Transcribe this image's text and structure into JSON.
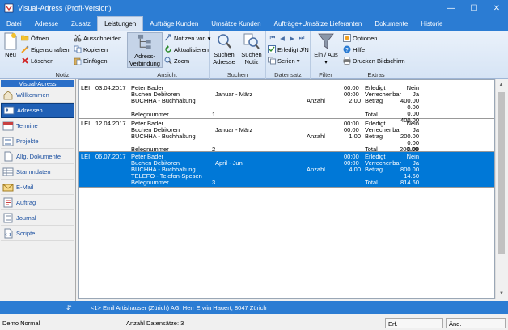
{
  "window": {
    "title": "Visual-Adress (Profi-Version)",
    "minimize": "—",
    "maximize": "☐",
    "close": "✕"
  },
  "menu": {
    "tabs": [
      "Datei",
      "Adresse",
      "Zusatz",
      "Leistungen",
      "Aufträge Kunden",
      "Umsätze Kunden",
      "Aufträge+Umsätze Lieferanten",
      "Dokumente",
      "Historie"
    ],
    "active": "Leistungen"
  },
  "ribbon": {
    "notiz": {
      "label": "Notiz",
      "neu": "Neu",
      "oeffnen": "Öffnen",
      "eigenschaften": "Eigenschaften",
      "loeschen": "Löschen",
      "ausschneiden": "Ausschneiden",
      "kopieren": "Kopieren",
      "einfuegen": "Einfügen"
    },
    "ansicht": {
      "label": "Ansicht",
      "adress_verbindung": "Adress-\nVerbindung",
      "notizen_von": "Notizen von",
      "aktualisieren": "Aktualisieren",
      "zoom": "Zoom"
    },
    "suchen": {
      "label": "Suchen",
      "suchen_adresse": "Suchen\nAdresse",
      "suchen_notiz": "Suchen\nNotiz"
    },
    "datensatz": {
      "label": "Datensatz",
      "erledigt": "Erledigt J/N",
      "serien": "Serien"
    },
    "filter": {
      "label": "Filter",
      "ein_aus": "Ein / Aus"
    },
    "extras": {
      "label": "Extras",
      "optionen": "Optionen",
      "hilfe": "Hilfe",
      "drucken": "Drucken Bildschirm"
    }
  },
  "sidebar": {
    "header": "Visual-Adress",
    "items": [
      "Willkommen",
      "Adressen",
      "Termine",
      "Projekte",
      "Allg. Dokumente",
      "Stammdaten",
      "E-Mail",
      "Auftrag",
      "Journal",
      "Scripte"
    ],
    "active": "Adressen"
  },
  "entries": [
    {
      "type": "LEI",
      "date": "03.04.2017",
      "user": "Peter Bader",
      "kind": "Buchen Debitoren",
      "period": "Januar - März",
      "account": "BUCHHA - Buchhaltung",
      "amount_label": "Anzahl",
      "amount": "2.00",
      "extra": "",
      "beleg_label": "Belegnummer",
      "beleg": "1",
      "time1": "00:00",
      "time2": "00:00",
      "erledigt_label": "Erledigt",
      "erledigt": "Nein",
      "verrechenbar_label": "Verrechenbar",
      "verrechenbar": "Ja",
      "betrag_label": "Betrag",
      "betrag": "400.00",
      "sub1": "0.00",
      "sub2": "0.00",
      "total_label": "Total",
      "total": "400.00"
    },
    {
      "type": "LEI",
      "date": "12.04.2017",
      "user": "Peter Bader",
      "kind": "Buchen Debitoren",
      "period": "Januar - März",
      "account": "BUCHHA - Buchhaltung",
      "amount_label": "Anzahl",
      "amount": "1.00",
      "extra": "",
      "beleg_label": "Belegnummer",
      "beleg": "2",
      "time1": "00:00",
      "time2": "00:00",
      "erledigt_label": "Erledigt",
      "erledigt": "Nein",
      "verrechenbar_label": "Verrechenbar",
      "verrechenbar": "Ja",
      "betrag_label": "Betrag",
      "betrag": "200.00",
      "sub1": "0.00",
      "sub2": "0.00",
      "total_label": "Total",
      "total": "200.00"
    },
    {
      "type": "LEI",
      "date": "06.07.2017",
      "user": "Peter Bader",
      "kind": "Buchen Debitoren",
      "period": "April - Juni",
      "account": "BUCHHA - Buchhaltung",
      "amount_label": "Anzahl",
      "amount": "4.00",
      "extra": "TELEFO - Telefon-Spesen",
      "beleg_label": "Belegnummer",
      "beleg": "3",
      "time1": "00:00",
      "time2": "00:00",
      "erledigt_label": "Erledigt",
      "erledigt": "Nein",
      "verrechenbar_label": "Verrechenbar",
      "verrechenbar": "Ja",
      "betrag_label": "Betrag",
      "betrag": "800.00",
      "sub1": "14.60",
      "sub2": "",
      "total_label": "Total",
      "total": "814.60"
    }
  ],
  "selected_entry": 2,
  "infobar": {
    "toggle": "⇵",
    "address": "<1> Emil Artishauser (Zürich) AG, Herr Erwin Hauert, 8047 Zürich"
  },
  "status": {
    "mode": "Demo Normal",
    "count": "Anzahl Datensätze: 3",
    "erf": "Erf.",
    "aend": "Änd."
  },
  "colors": {
    "accent": "#2b7cd3",
    "selection": "#0078d7",
    "sidebar_active": "#1f5fb5"
  }
}
